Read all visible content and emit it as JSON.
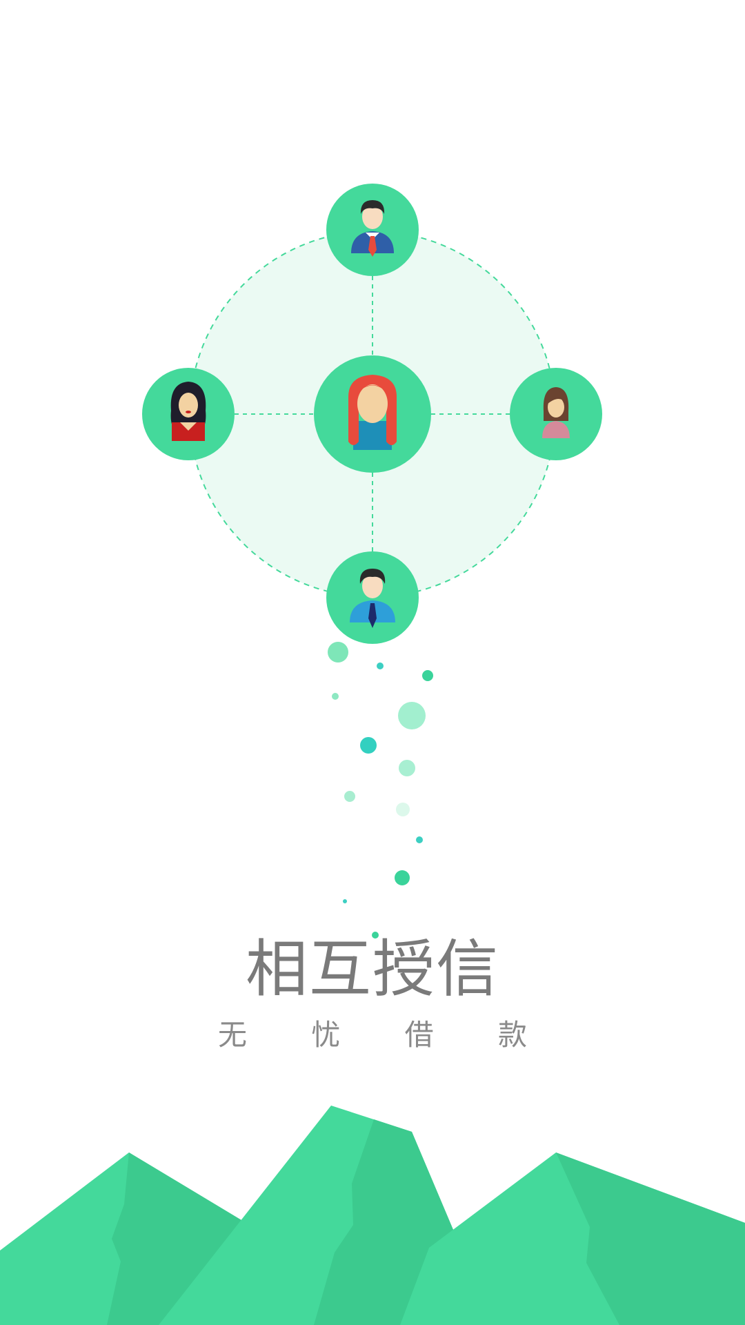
{
  "headline": "相互授信",
  "tagline": "无 忧 借 款",
  "colors": {
    "accent": "#44d99b",
    "accent_dark": "#3cca8e",
    "ring_fill": "#ebfaf3",
    "text_primary": "#7a7a7a",
    "text_secondary": "#8a8a8a"
  },
  "network": {
    "center_avatar": "woman-red-hair-avatar-icon",
    "outer_avatars": [
      "man-blue-suit-red-tie-avatar-icon",
      "woman-black-curly-hair-avatar-icon",
      "woman-brown-hair-avatar-icon",
      "man-blue-shirt-dark-tie-avatar-icon"
    ]
  }
}
